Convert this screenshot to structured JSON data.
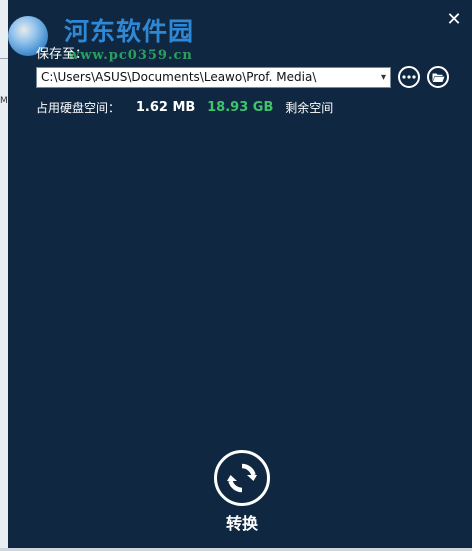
{
  "watermark": {
    "site_name": "河东软件园",
    "url": "www.pc0359.cn"
  },
  "left_strip": {
    "letter": "M"
  },
  "dialog": {
    "close_glyph": "✕",
    "save_to_label": "保存至：",
    "path_value": "C:\\Users\\ASUS\\Documents\\Leawo\\Prof. Media\\",
    "dropdown_glyph": "▾",
    "disk": {
      "used_label": "占用硬盘空间：",
      "used_value": "1.62 MB",
      "free_value": "18.93 GB",
      "free_label": "剩余空间"
    },
    "convert_label": "转换"
  },
  "icons": {
    "more": "more-horizontal-icon",
    "folder": "folder-open-icon",
    "convert": "refresh-icon",
    "close": "close-icon"
  },
  "colors": {
    "background": "#0f2740",
    "free_space": "#3ec46d",
    "watermark_text": "#2f88d6",
    "watermark_url": "#2aa060"
  }
}
